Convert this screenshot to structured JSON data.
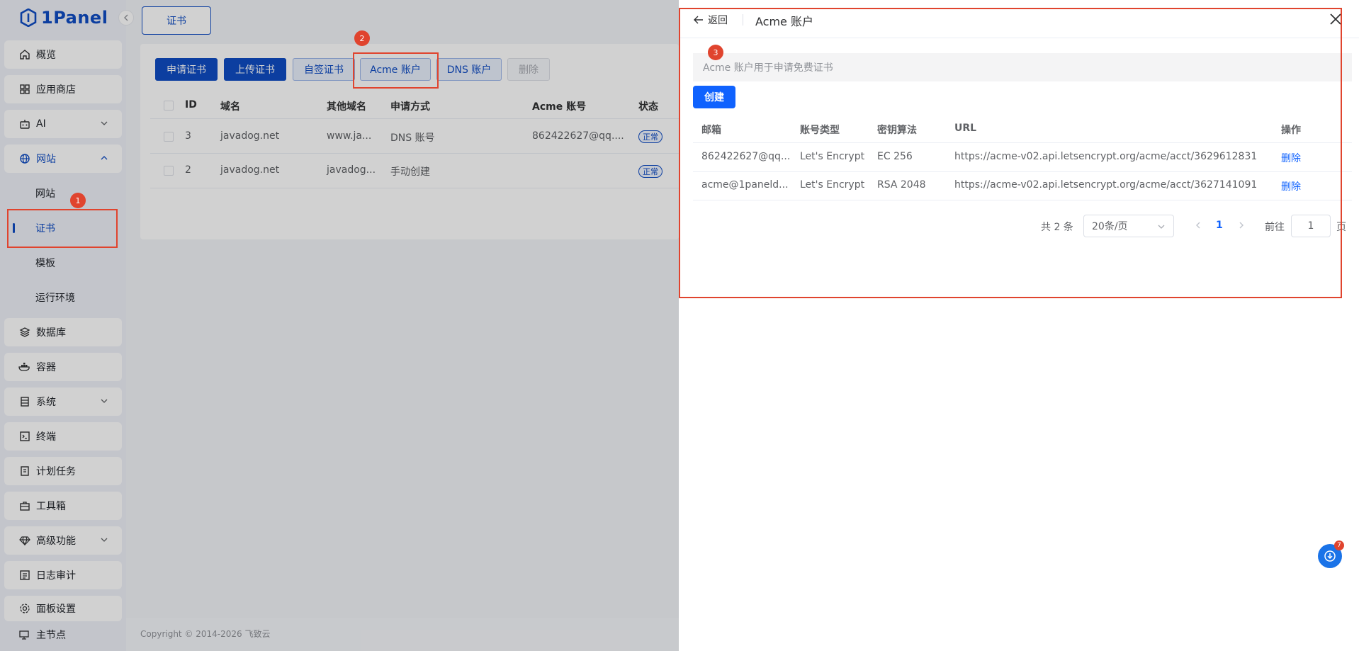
{
  "app": {
    "logo_text": "1Panel"
  },
  "sidebar": {
    "items": [
      {
        "label": "概览",
        "icon": "home-icon"
      },
      {
        "label": "应用商店",
        "icon": "grid-icon"
      },
      {
        "label": "AI",
        "icon": "robot-icon"
      },
      {
        "label": "网站",
        "icon": "globe-icon"
      },
      {
        "label": "数据库",
        "icon": "layers-icon"
      },
      {
        "label": "容器",
        "icon": "docker-icon"
      },
      {
        "label": "系统",
        "icon": "server-icon"
      },
      {
        "label": "终端",
        "icon": "terminal-icon"
      },
      {
        "label": "计划任务",
        "icon": "calendar-icon"
      },
      {
        "label": "工具箱",
        "icon": "toolbox-icon"
      },
      {
        "label": "高级功能",
        "icon": "diamond-icon"
      },
      {
        "label": "日志审计",
        "icon": "log-icon"
      },
      {
        "label": "面板设置",
        "icon": "gear-icon"
      }
    ],
    "website_sub": [
      "网站",
      "证书",
      "模板",
      "运行环境"
    ],
    "node_label": "主节点"
  },
  "main": {
    "tab": "证书",
    "buttons": [
      "申请证书",
      "上传证书",
      "自签证书",
      "Acme 账户",
      "DNS 账户",
      "删除"
    ],
    "columns": [
      "ID",
      "域名",
      "其他域名",
      "申请方式",
      "Acme 账号",
      "状态"
    ],
    "rows": [
      {
        "id": "3",
        "domain": "javadog.net",
        "other": "www.ja...",
        "method": "DNS 账号",
        "acme": "862422627@qq....",
        "status": "正常"
      },
      {
        "id": "2",
        "domain": "javadog.net",
        "other": "javadog...",
        "method": "手动创建",
        "acme": "",
        "status": "正常"
      }
    ],
    "footer": "Copyright © 2014-2026 飞致云"
  },
  "drawer": {
    "back_label": "返回",
    "title": "Acme 账户",
    "info": "Acme 账户用于申请免费证书",
    "create_label": "创建",
    "columns": [
      "邮箱",
      "账号类型",
      "密钥算法",
      "URL",
      "操作"
    ],
    "rows": [
      {
        "email": "862422627@qq...",
        "type": "Let's Encrypt",
        "algo": "EC 256",
        "url": "https://acme-v02.api.letsencrypt.org/acme/acct/3629612831",
        "action": "删除"
      },
      {
        "email": "acme@1paneld...",
        "type": "Let's Encrypt",
        "algo": "RSA 2048",
        "url": "https://acme-v02.api.letsencrypt.org/acme/acct/3627141091",
        "action": "删除"
      }
    ],
    "pager": {
      "total": "共 2 条",
      "page_size": "20条/页",
      "current": "1",
      "goto_label": "前往",
      "goto_value": "1",
      "goto_suffix": "页"
    }
  },
  "annotations": [
    "1",
    "2",
    "3"
  ],
  "float_badge": "7",
  "colors": {
    "primary": "#0f4cc4",
    "link": "#0f62fe",
    "annotation": "#e0442e"
  }
}
